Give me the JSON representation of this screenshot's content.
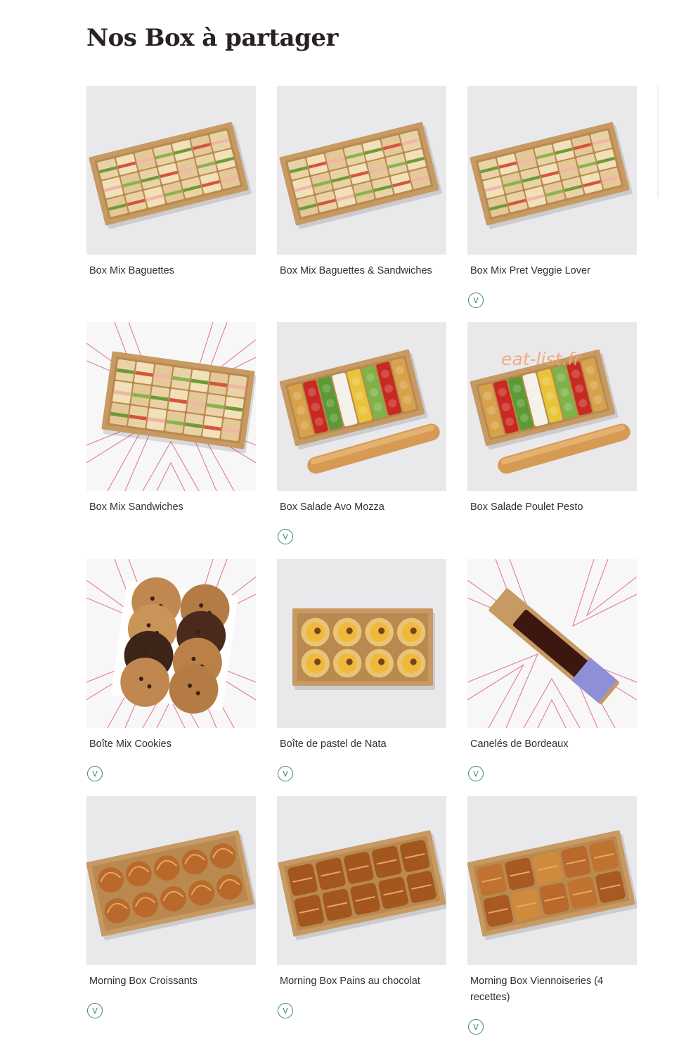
{
  "page": {
    "title": "Nos Box à partager",
    "watermark": "eat-list.fr"
  },
  "veg_badge_label": "V",
  "products": [
    {
      "name": "Box Mix Baguettes",
      "vegetarian": false,
      "image": "box-sandwich-tray",
      "background": "plain"
    },
    {
      "name": "Box Mix Baguettes & Sandwiches",
      "vegetarian": false,
      "image": "box-sandwich-tray",
      "background": "plain"
    },
    {
      "name": "Box Mix Pret Veggie Lover",
      "vegetarian": true,
      "image": "box-sandwich-tray",
      "background": "plain"
    },
    {
      "name": "Box Mix Sandwiches",
      "vegetarian": false,
      "image": "box-sandwich-tray",
      "background": "star-pattern"
    },
    {
      "name": "Box Salade Avo Mozza",
      "vegetarian": true,
      "image": "box-salad-with-baguette",
      "background": "plain"
    },
    {
      "name": "Box Salade Poulet Pesto",
      "vegetarian": false,
      "image": "box-salad-with-baguette",
      "background": "plain"
    },
    {
      "name": "Boîte Mix Cookies",
      "vegetarian": true,
      "image": "box-cookies",
      "background": "star-pattern"
    },
    {
      "name": "Boîte de pastel de Nata",
      "vegetarian": true,
      "image": "box-pastel-de-nata",
      "background": "plain"
    },
    {
      "name": "Canelés de Bordeaux",
      "vegetarian": true,
      "image": "box-canele-tube",
      "background": "star-pattern"
    },
    {
      "name": "Morning Box Croissants",
      "vegetarian": true,
      "image": "box-croissants",
      "background": "plain"
    },
    {
      "name": "Morning Box Pains au chocolat",
      "vegetarian": true,
      "image": "box-pains-au-chocolat",
      "background": "plain"
    },
    {
      "name": "Morning Box Viennoiseries (4 recettes)",
      "vegetarian": true,
      "image": "box-viennoiseries",
      "background": "plain"
    }
  ],
  "colors": {
    "veg_badge": "#3e8a62",
    "kraft_box": "#c79a63",
    "star_lines": "#d9547a",
    "photo_bg": "#e9e9eb"
  }
}
